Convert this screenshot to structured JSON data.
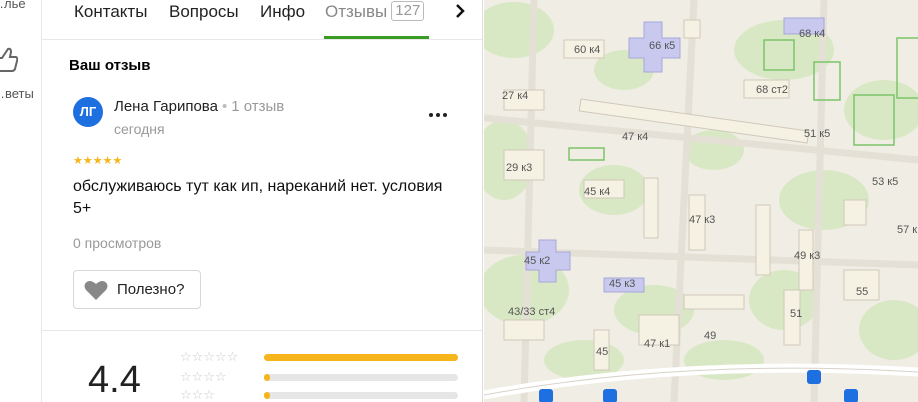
{
  "rail": {
    "item1_label": "…лье",
    "item2_label": "…веты"
  },
  "tabs": [
    {
      "label": "Контакты"
    },
    {
      "label": "Вопросы"
    },
    {
      "label": "Инфо"
    },
    {
      "label": "Отзывы",
      "count": "127",
      "active": true
    }
  ],
  "review_section": {
    "title": "Ваш отзыв",
    "avatar_initials": "ЛГ",
    "author_name": "Лена Гарипова",
    "author_reviews": "1 отзыв",
    "date": "сегодня",
    "stars": 5,
    "text": "обслуживаюсь тут как ип, нареканий нет. условия 5+",
    "views": "0 просмотров",
    "useful_label": "Полезно?"
  },
  "summary": {
    "rating": "4.4",
    "distribution": [
      {
        "stars": 5,
        "fraction": 1.0
      },
      {
        "stars": 4,
        "fraction": 0.03
      },
      {
        "stars": 3,
        "fraction": 0.03
      }
    ]
  },
  "map": {
    "labels": [
      "60 к4",
      "66 к5",
      "68 к4",
      "27 к4",
      "68 ст2",
      "47 к4",
      "51 к5",
      "29 к3",
      "45 к4",
      "53 к5",
      "47 к3",
      "57 к",
      "45 к2",
      "49 к3",
      "45 к3",
      "55",
      "43/33 ст4",
      "51",
      "45",
      "47 к1",
      "49"
    ]
  },
  "colors": {
    "accent_green": "#3a9b22",
    "star": "#f5b51b",
    "avatar": "#1e6fe0"
  }
}
